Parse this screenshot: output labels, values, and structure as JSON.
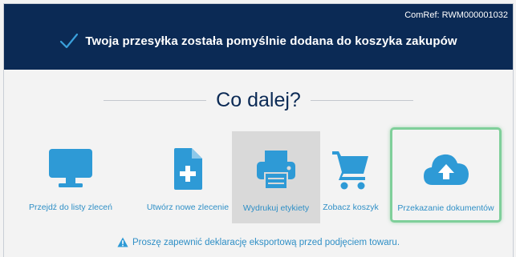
{
  "header": {
    "comref": "ComRef: RWM000001032",
    "success_message": "Twoja przesyłka została pomyślnie dodana do koszyka zakupów"
  },
  "section_title": "Co dalej?",
  "actions": [
    {
      "label": "Przejdź do listy zleceń",
      "icon": "monitor-icon"
    },
    {
      "label": "Utwórz nowe zlecenie",
      "icon": "new-document-icon"
    },
    {
      "label": "Wydrukuj etykiety",
      "icon": "printer-icon"
    },
    {
      "label": "Zobacz koszyk",
      "icon": "shopping-cart-icon"
    },
    {
      "label": "Przekazanie dokumentów",
      "icon": "cloud-upload-icon"
    }
  ],
  "warning": "Proszę zapewnić deklarację eksportową przed podjęciem towaru.",
  "colors": {
    "header_bg": "#0b2a55",
    "accent": "#2f8fc6",
    "icon": "#2e9ad6",
    "highlight_border": "#7fcf9a",
    "selected_bg": "#d9d9d9"
  }
}
